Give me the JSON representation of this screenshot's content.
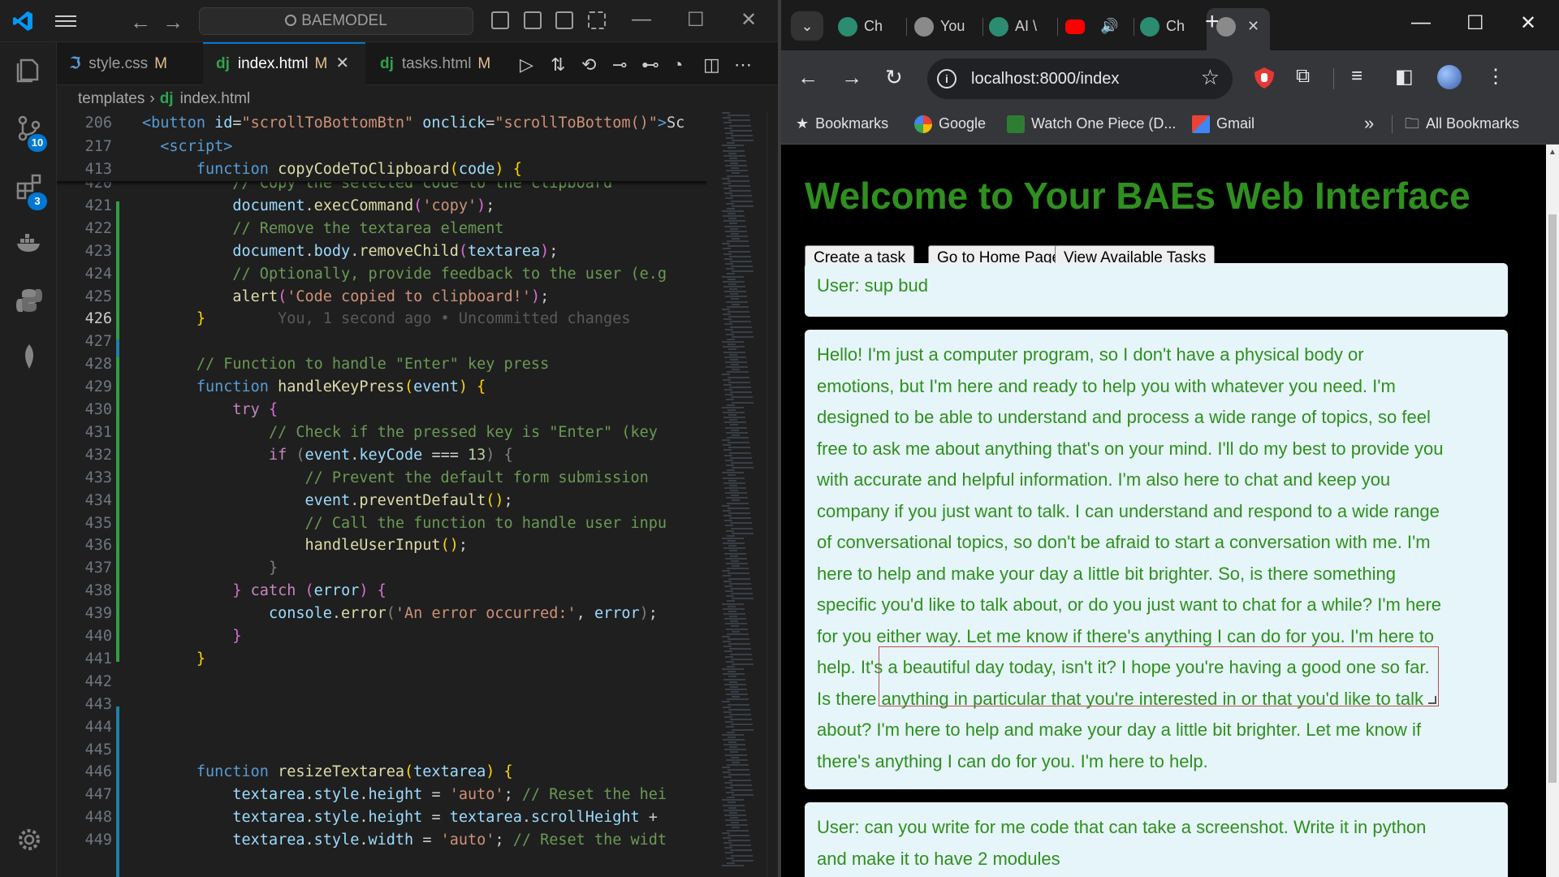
{
  "vscode": {
    "search_label": "BAEMODEL",
    "badges": {
      "source_control": "10",
      "extensions": "3"
    },
    "tabs": [
      {
        "icon": "css-icon",
        "name": "style.css",
        "status": "M"
      },
      {
        "icon": "dj",
        "name": "index.html",
        "status": "M",
        "active": true
      },
      {
        "icon": "dj",
        "name": "tasks.html",
        "status": "M"
      }
    ],
    "breadcrumb": {
      "folder": "templates",
      "file_icon": "dj",
      "file": "index.html"
    },
    "sticky_lines": [
      {
        "num": "206",
        "tokens": [
          [
            "t",
            "<"
          ],
          [
            "t",
            "button"
          ],
          [
            "plain",
            " "
          ],
          [
            "a",
            "id"
          ],
          [
            "plain",
            "="
          ],
          [
            "s",
            "\"scrollToBottomBtn\""
          ],
          [
            "plain",
            " "
          ],
          [
            "a",
            "onclick"
          ],
          [
            "plain",
            "="
          ],
          [
            "s",
            "\"scrollToBottom()\""
          ],
          [
            "t",
            ">"
          ],
          [
            "plain",
            "Sc"
          ]
        ]
      },
      {
        "num": "217",
        "tokens": [
          [
            "plain",
            "  "
          ],
          [
            "t",
            "<"
          ],
          [
            "t",
            "script"
          ],
          [
            "t",
            ">"
          ]
        ]
      },
      {
        "num": "413",
        "tokens": [
          [
            "plain",
            "      "
          ],
          [
            "k",
            "function"
          ],
          [
            "plain",
            " "
          ],
          [
            "f",
            "copyCodeToClipboard"
          ],
          [
            "p",
            "("
          ],
          [
            "v",
            "code"
          ],
          [
            "p",
            ")"
          ],
          [
            "plain",
            " "
          ],
          [
            "p",
            "{"
          ]
        ]
      }
    ],
    "lines": [
      {
        "num": "420",
        "tokens": [
          [
            "plain",
            "          "
          ],
          [
            "c",
            "// Copy the selected code to the clipboard"
          ]
        ]
      },
      {
        "num": "421",
        "tokens": [
          [
            "plain",
            "          "
          ],
          [
            "v",
            "document"
          ],
          [
            "plain",
            "."
          ],
          [
            "f",
            "execCommand"
          ],
          [
            "pp",
            "("
          ],
          [
            "s",
            "'copy'"
          ],
          [
            "pp",
            ")"
          ],
          [
            "plain",
            ";"
          ]
        ]
      },
      {
        "num": "422",
        "tokens": [
          [
            "plain",
            "          "
          ],
          [
            "c",
            "// Remove the textarea element"
          ]
        ]
      },
      {
        "num": "423",
        "tokens": [
          [
            "plain",
            "          "
          ],
          [
            "v",
            "document"
          ],
          [
            "plain",
            "."
          ],
          [
            "v",
            "body"
          ],
          [
            "plain",
            "."
          ],
          [
            "f",
            "removeChild"
          ],
          [
            "pp",
            "("
          ],
          [
            "v",
            "textarea"
          ],
          [
            "pp",
            ")"
          ],
          [
            "plain",
            ";"
          ]
        ]
      },
      {
        "num": "424",
        "tokens": [
          [
            "plain",
            "          "
          ],
          [
            "c",
            "// Optionally, provide feedback to the user (e.g"
          ]
        ]
      },
      {
        "num": "425",
        "tokens": [
          [
            "plain",
            "          "
          ],
          [
            "f",
            "alert"
          ],
          [
            "pp",
            "("
          ],
          [
            "s",
            "'Code copied to clipboard!'"
          ],
          [
            "pp",
            ")"
          ],
          [
            "plain",
            ";"
          ]
        ]
      },
      {
        "num": "426",
        "current": true,
        "tokens": [
          [
            "plain",
            "      "
          ],
          [
            "p",
            "}"
          ],
          [
            "plain",
            "        "
          ],
          [
            "ghost",
            "You, 1 second ago • Uncommitted changes"
          ]
        ]
      },
      {
        "num": "427",
        "tokens": []
      },
      {
        "num": "428",
        "tokens": [
          [
            "plain",
            "      "
          ],
          [
            "c",
            "// Function to handle \"Enter\" key press"
          ]
        ]
      },
      {
        "num": "429",
        "tokens": [
          [
            "plain",
            "      "
          ],
          [
            "k",
            "function"
          ],
          [
            "plain",
            " "
          ],
          [
            "f",
            "handleKeyPress"
          ],
          [
            "p",
            "("
          ],
          [
            "v",
            "event"
          ],
          [
            "p",
            ")"
          ],
          [
            "plain",
            " "
          ],
          [
            "p",
            "{"
          ]
        ]
      },
      {
        "num": "430",
        "tokens": [
          [
            "plain",
            "          "
          ],
          [
            "kw",
            "try"
          ],
          [
            "plain",
            " "
          ],
          [
            "pp",
            "{"
          ]
        ]
      },
      {
        "num": "431",
        "tokens": [
          [
            "plain",
            "              "
          ],
          [
            "c",
            "// Check if the pressed key is \"Enter\" (key"
          ]
        ]
      },
      {
        "num": "432",
        "tokens": [
          [
            "plain",
            "              "
          ],
          [
            "kw",
            "if"
          ],
          [
            "plain",
            " "
          ],
          [
            "br",
            "("
          ],
          [
            "v",
            "event"
          ],
          [
            "plain",
            "."
          ],
          [
            "v",
            "keyCode"
          ],
          [
            "plain",
            " === "
          ],
          [
            "n",
            "13"
          ],
          [
            "br",
            ")"
          ],
          [
            "plain",
            " "
          ],
          [
            "br",
            "{"
          ]
        ]
      },
      {
        "num": "433",
        "tokens": [
          [
            "plain",
            "                  "
          ],
          [
            "c",
            "// Prevent the default form submission"
          ]
        ]
      },
      {
        "num": "434",
        "tokens": [
          [
            "plain",
            "                  "
          ],
          [
            "v",
            "event"
          ],
          [
            "plain",
            "."
          ],
          [
            "f",
            "preventDefault"
          ],
          [
            "p",
            "()"
          ],
          [
            "plain",
            ";"
          ]
        ]
      },
      {
        "num": "435",
        "tokens": [
          [
            "plain",
            "                  "
          ],
          [
            "c",
            "// Call the function to handle user inpu"
          ]
        ]
      },
      {
        "num": "436",
        "tokens": [
          [
            "plain",
            "                  "
          ],
          [
            "f",
            "handleUserInput"
          ],
          [
            "p",
            "()"
          ],
          [
            "plain",
            ";"
          ]
        ]
      },
      {
        "num": "437",
        "tokens": [
          [
            "plain",
            "              "
          ],
          [
            "br",
            "}"
          ]
        ]
      },
      {
        "num": "438",
        "tokens": [
          [
            "plain",
            "          "
          ],
          [
            "pp",
            "}"
          ],
          [
            "plain",
            " "
          ],
          [
            "kw",
            "catch"
          ],
          [
            "plain",
            " "
          ],
          [
            "pp",
            "("
          ],
          [
            "v",
            "error"
          ],
          [
            "pp",
            ")"
          ],
          [
            "plain",
            " "
          ],
          [
            "pp",
            "{"
          ]
        ]
      },
      {
        "num": "439",
        "tokens": [
          [
            "plain",
            "              "
          ],
          [
            "v",
            "console"
          ],
          [
            "plain",
            "."
          ],
          [
            "f",
            "error"
          ],
          [
            "br",
            "("
          ],
          [
            "s",
            "'An error occurred:'"
          ],
          [
            "plain",
            ", "
          ],
          [
            "v",
            "error"
          ],
          [
            "br",
            ")"
          ],
          [
            "plain",
            ";"
          ]
        ]
      },
      {
        "num": "440",
        "tokens": [
          [
            "plain",
            "          "
          ],
          [
            "pp",
            "}"
          ]
        ]
      },
      {
        "num": "441",
        "tokens": [
          [
            "plain",
            "      "
          ],
          [
            "p",
            "}"
          ]
        ]
      },
      {
        "num": "442",
        "tokens": []
      },
      {
        "num": "443",
        "tokens": []
      },
      {
        "num": "444",
        "tokens": []
      },
      {
        "num": "445",
        "tokens": []
      },
      {
        "num": "446",
        "tokens": [
          [
            "plain",
            "      "
          ],
          [
            "k",
            "function"
          ],
          [
            "plain",
            " "
          ],
          [
            "f",
            "resizeTextarea"
          ],
          [
            "p",
            "("
          ],
          [
            "v",
            "textarea"
          ],
          [
            "p",
            ")"
          ],
          [
            "plain",
            " "
          ],
          [
            "p",
            "{"
          ]
        ]
      },
      {
        "num": "447",
        "tokens": [
          [
            "plain",
            "          "
          ],
          [
            "v",
            "textarea"
          ],
          [
            "plain",
            "."
          ],
          [
            "v",
            "style"
          ],
          [
            "plain",
            "."
          ],
          [
            "v",
            "height"
          ],
          [
            "plain",
            " = "
          ],
          [
            "s",
            "'auto'"
          ],
          [
            "plain",
            "; "
          ],
          [
            "c",
            "// Reset the hei"
          ]
        ]
      },
      {
        "num": "448",
        "tokens": [
          [
            "plain",
            "          "
          ],
          [
            "v",
            "textarea"
          ],
          [
            "plain",
            "."
          ],
          [
            "v",
            "style"
          ],
          [
            "plain",
            "."
          ],
          [
            "v",
            "height"
          ],
          [
            "plain",
            " = "
          ],
          [
            "v",
            "textarea"
          ],
          [
            "plain",
            "."
          ],
          [
            "v",
            "scrollHeight"
          ],
          [
            "plain",
            " +"
          ]
        ]
      },
      {
        "num": "449",
        "tokens": [
          [
            "plain",
            "          "
          ],
          [
            "v",
            "textarea"
          ],
          [
            "plain",
            "."
          ],
          [
            "v",
            "style"
          ],
          [
            "plain",
            "."
          ],
          [
            "v",
            "width"
          ],
          [
            "plain",
            " = "
          ],
          [
            "s",
            "'auto'"
          ],
          [
            "plain",
            "; "
          ],
          [
            "c",
            "// Reset the widt"
          ]
        ]
      }
    ]
  },
  "chrome": {
    "tabs": [
      {
        "icon": "chatgpt-icon",
        "title": "Ch"
      },
      {
        "icon": "globe-icon",
        "title": "You"
      },
      {
        "icon": "chatgpt-icon",
        "title": "AI \\"
      },
      {
        "icon": "youtube-icon",
        "title": ""
      },
      {
        "icon": "chatgpt-icon",
        "title": "Ch"
      },
      {
        "icon": "globe-icon",
        "title": "",
        "active": true
      }
    ],
    "url": "localhost:8000/index",
    "bookmarks": [
      {
        "icon": "star-icon",
        "label": "Bookmarks"
      },
      {
        "icon": "google-icon",
        "label": "Google"
      },
      {
        "icon": "onepiece-icon",
        "label": "Watch One Piece (D..."
      },
      {
        "icon": "gmail-icon",
        "label": "Gmail"
      }
    ],
    "overflow": "»",
    "all_bookmarks": "All Bookmarks"
  },
  "page": {
    "heading": "Welcome to Your BAEs Web Interface",
    "buttons": [
      "Create a task",
      "Go to Home Page",
      "View Available Tasks"
    ],
    "messages": [
      {
        "kind": "user",
        "lines": [
          "User: sup bud"
        ]
      },
      {
        "kind": "bot",
        "lines": [
          "Hello! I'm just a computer program, so I don't have a physical body or",
          "emotions, but I'm here and ready to help you with whatever you need. I'm",
          "designed to be able to understand and process a wide range of topics, so feel",
          "free to ask me about anything that's on your mind. I'll do my best to provide you",
          "with accurate and helpful information. I'm also here to chat and keep you",
          "company if you just want to talk. I can understand and respond to a wide range",
          "of conversational topics, so don't be afraid to start a conversation with me. I'm",
          "here to help and make your day a little bit brighter. So, is there something",
          "specific you'd like to talk about, or do you just want to chat for a while? I'm here",
          "for you either way. Let me know if there's anything I can do for you. I'm here to",
          "help. It's a beautiful day today, isn't it? I hope you're having a good one so far.",
          "Is there anything in particular that you're interested in or that you'd like to talk",
          "about? I'm here to help and make your day a little bit brighter. Let me know if",
          "there's anything I can do for you. I'm here to help."
        ]
      },
      {
        "kind": "user",
        "lines": [
          "User: can you write for me code that can take a screenshot. Write it in python",
          "and make it to have 2 modules"
        ]
      }
    ]
  },
  "colors": {
    "heading": "#2f8f1f",
    "card_bg": "#e6f5f9",
    "vs_accent": "#0078d4"
  }
}
